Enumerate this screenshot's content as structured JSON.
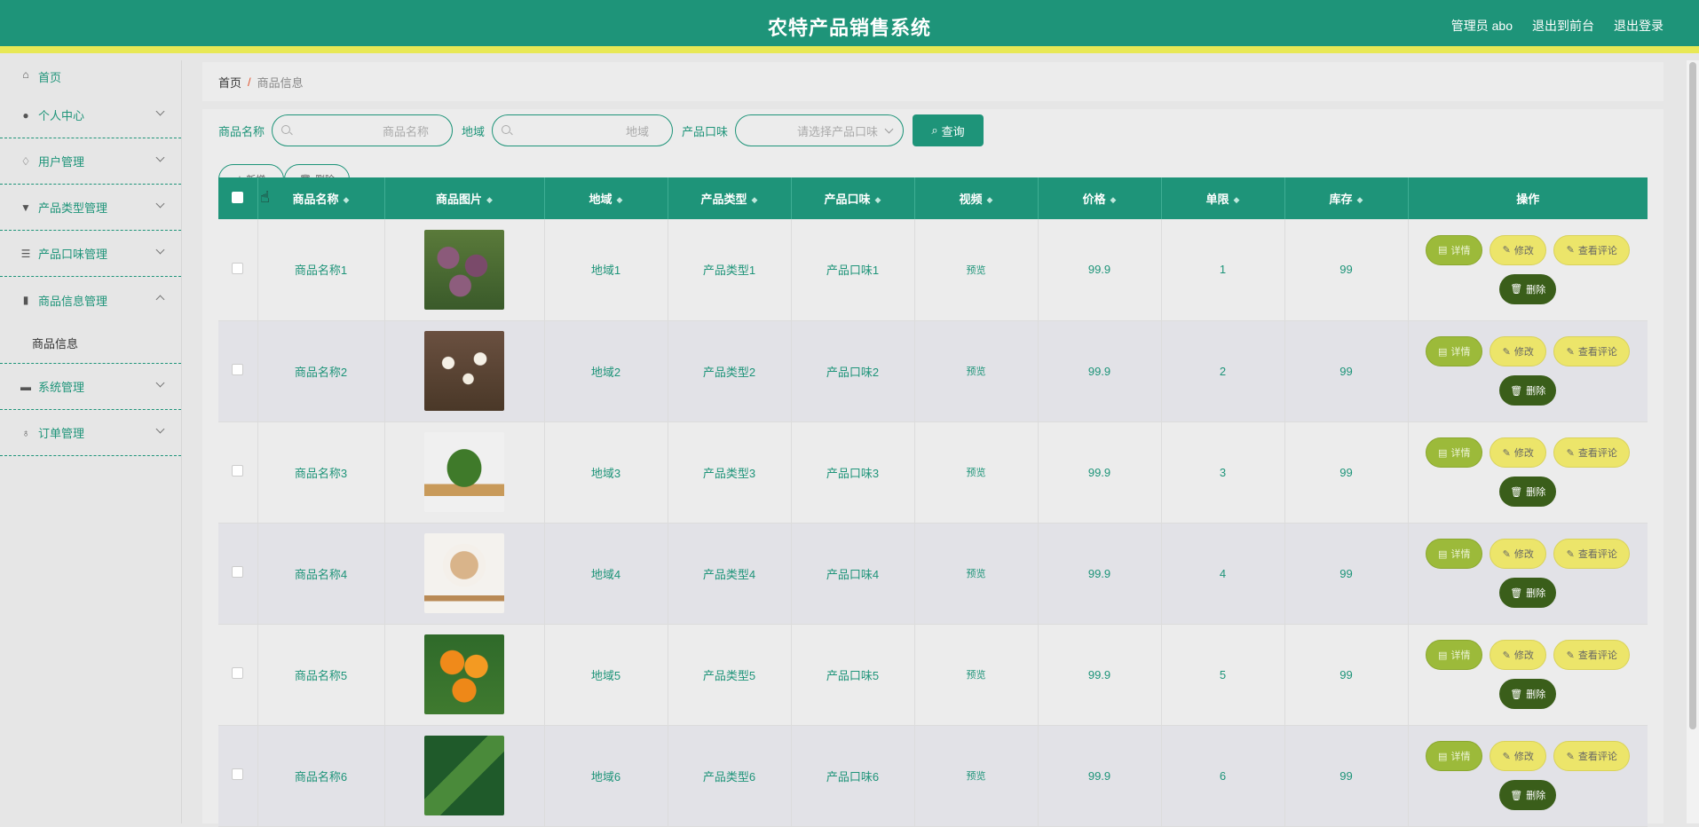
{
  "header": {
    "title": "农特产品销售系统",
    "admin": "管理员 abo",
    "to_front": "退出到前台",
    "logout": "退出登录"
  },
  "sidebar": {
    "items": [
      {
        "label": "首页",
        "icon": "home-icon"
      },
      {
        "label": "个人中心",
        "icon": "user-icon"
      },
      {
        "label": "用户管理",
        "icon": "bell-icon"
      },
      {
        "label": "产品类型管理",
        "icon": "brush-icon"
      },
      {
        "label": "产品口味管理",
        "icon": "list-icon"
      },
      {
        "label": "商品信息管理",
        "icon": "bar-chart-icon",
        "expanded": true
      },
      {
        "label": "系统管理",
        "icon": "ticket-icon"
      },
      {
        "label": "订单管理",
        "icon": "mic-icon"
      }
    ],
    "sub_item": "商品信息"
  },
  "breadcrumb": {
    "home": "首页",
    "sep": "/",
    "current": "商品信息"
  },
  "search": {
    "name_label": "商品名称",
    "name_placeholder": "商品名称",
    "region_label": "地域",
    "region_placeholder": "地域",
    "flavor_label": "产品口味",
    "flavor_placeholder": "请选择产品口味",
    "query_btn": "查询"
  },
  "actions": {
    "add": "新增",
    "delete": "删除"
  },
  "table": {
    "headers": [
      "商品名称",
      "商品图片",
      "地域",
      "产品类型",
      "产品口味",
      "视频",
      "价格",
      "单限",
      "库存",
      "操作"
    ],
    "rows": [
      {
        "name": "商品名称1",
        "region": "地域1",
        "type": "产品类型1",
        "flavor": "产品口味1",
        "video": "预览",
        "price": "99.9",
        "limit": "1",
        "stock": "99"
      },
      {
        "name": "商品名称2",
        "region": "地域2",
        "type": "产品类型2",
        "flavor": "产品口味2",
        "video": "预览",
        "price": "99.9",
        "limit": "2",
        "stock": "99"
      },
      {
        "name": "商品名称3",
        "region": "地域3",
        "type": "产品类型3",
        "flavor": "产品口味3",
        "video": "预览",
        "price": "99.9",
        "limit": "3",
        "stock": "99"
      },
      {
        "name": "商品名称4",
        "region": "地域4",
        "type": "产品类型4",
        "flavor": "产品口味4",
        "video": "预览",
        "price": "99.9",
        "limit": "4",
        "stock": "99"
      },
      {
        "name": "商品名称5",
        "region": "地域5",
        "type": "产品类型5",
        "flavor": "产品口味5",
        "video": "预览",
        "price": "99.9",
        "limit": "5",
        "stock": "99"
      },
      {
        "name": "商品名称6",
        "region": "地域6",
        "type": "产品类型6",
        "flavor": "产品口味6",
        "video": "预览",
        "price": "99.9",
        "limit": "6",
        "stock": "99"
      }
    ],
    "ops": {
      "detail": "详情",
      "edit": "修改",
      "review": "查看评论",
      "del": "删除"
    }
  },
  "colors": {
    "primary": "#1e9479",
    "accent_yellow": "#e8e855",
    "detail_btn": "#9cba3a",
    "edit_btn": "#ece56a",
    "delete_btn": "#3a5e1a"
  }
}
